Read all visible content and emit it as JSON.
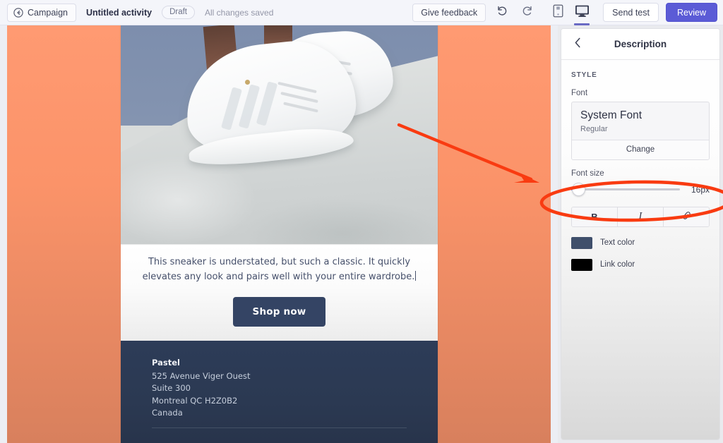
{
  "topbar": {
    "campaign_button": "Campaign",
    "back_icon": "back-arrow-circle-icon",
    "activity_title": "Untitled activity",
    "status_badge": "Draft",
    "save_status": "All changes saved",
    "feedback_button": "Give feedback",
    "undo_icon": "undo-icon",
    "redo_icon": "redo-icon",
    "mobile_preview_icon": "mobile-device-icon",
    "desktop_preview_icon": "desktop-monitor-icon",
    "active_preview": "desktop",
    "send_test_button": "Send test",
    "review_button": "Review",
    "review_button_color": "#5b5bd6",
    "active_tab_underline_color": "#6a6ac4"
  },
  "canvas": {
    "background_color": "#ff9a72",
    "email": {
      "hero_image_alt": "white sneakers on light gray floor",
      "body_text": "This sneaker is understated, but such a classic. It quickly elevates any look and pairs well with your entire wardrobe.",
      "cta_label": "Shop now",
      "cta_color": "#344464",
      "footer": {
        "company": "Pastel",
        "address_line_1": "525 Avenue Viger Ouest",
        "address_line_2": "Suite 300",
        "address_line_3": "Montreal QC H2Z0B2",
        "address_line_4": "Canada",
        "background_color": "#2d3c58"
      }
    }
  },
  "panel": {
    "back_icon": "chevron-left-icon",
    "title": "Description",
    "section_label": "STYLE",
    "font_label": "Font",
    "font_name": "System Font",
    "font_weight": "Regular",
    "change_button": "Change",
    "font_size_label": "Font size",
    "font_size_value": "16px",
    "bold_button": "B",
    "italic_button": "I",
    "link_icon": "link-chain-icon",
    "text_color_label": "Text color",
    "text_color_value": "#3f4f6b",
    "link_color_label": "Link color",
    "link_color_value": "#000000"
  },
  "annotations": {
    "arrow": {
      "name": "red-arrow-annotation",
      "color": "#f93b11"
    },
    "ellipse": {
      "name": "red-ellipse-annotation",
      "color": "#f93b11"
    }
  }
}
